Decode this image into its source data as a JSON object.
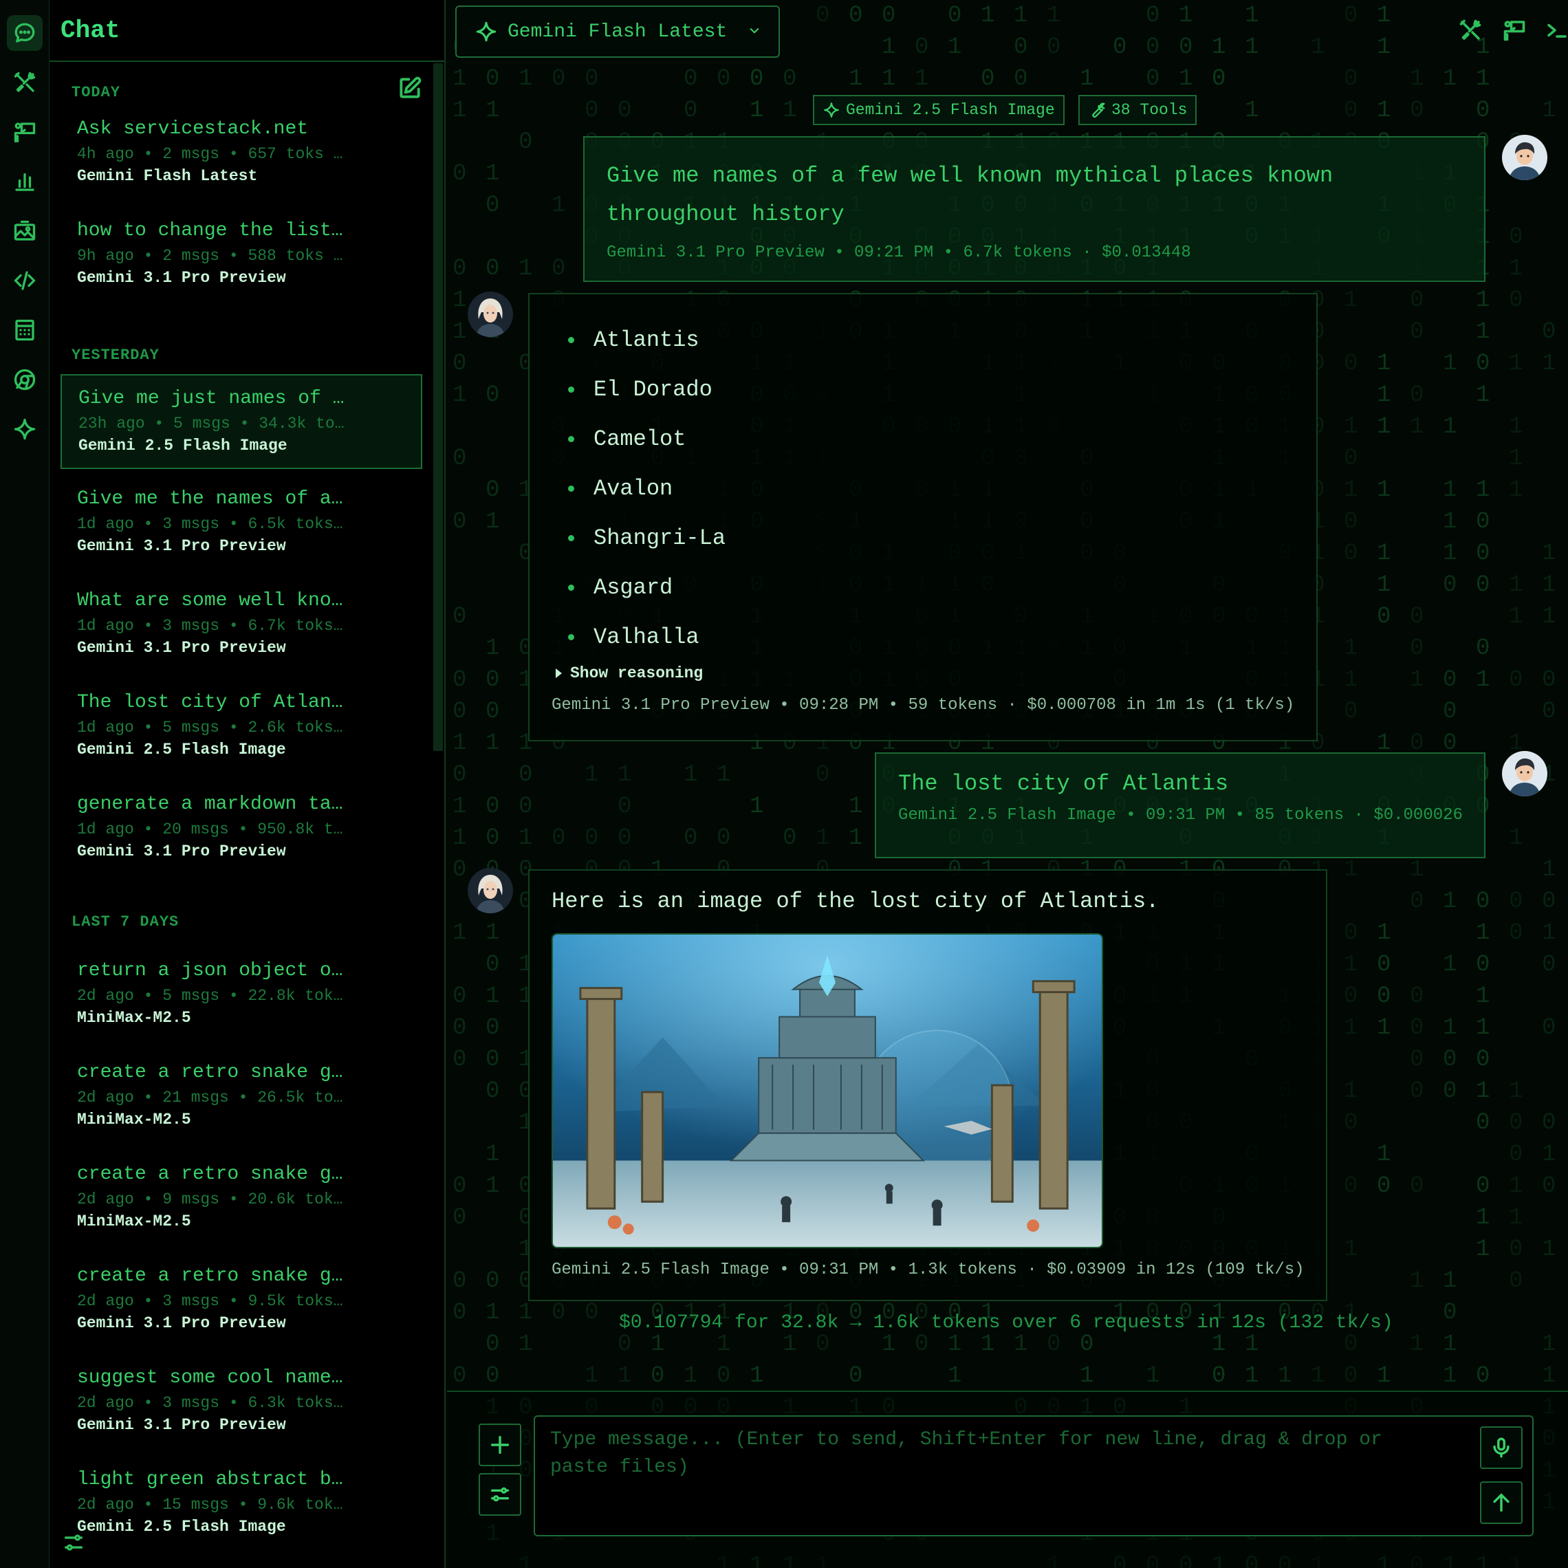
{
  "sidebar": {
    "title": "Chat",
    "groups": [
      {
        "label": "TODAY"
      },
      {
        "label": "YESTERDAY"
      },
      {
        "label": "LAST 7 DAYS"
      }
    ],
    "conversations": [
      {
        "title": "Ask servicestack.net",
        "meta": "4h ago • 2 msgs • 657 toks …",
        "model": "Gemini Flash Latest"
      },
      {
        "title": "how to change the list…",
        "meta": "9h ago • 2 msgs • 588 toks …",
        "model": "Gemini 3.1 Pro Preview"
      },
      {
        "title": "Give me just names of …",
        "meta": "23h ago • 5 msgs • 34.3k to…",
        "model": "Gemini 2.5 Flash Image"
      },
      {
        "title": "Give me the names of a…",
        "meta": "1d ago • 3 msgs • 6.5k toks…",
        "model": "Gemini 3.1 Pro Preview"
      },
      {
        "title": "What are some well kno…",
        "meta": "1d ago • 3 msgs • 6.7k toks…",
        "model": "Gemini 3.1 Pro Preview"
      },
      {
        "title": "The lost city of Atlan…",
        "meta": "1d ago • 5 msgs • 2.6k toks…",
        "model": "Gemini 2.5 Flash Image"
      },
      {
        "title": "generate a markdown ta…",
        "meta": "1d ago • 20 msgs • 950.8k t…",
        "model": "Gemini 3.1 Pro Preview"
      },
      {
        "title": "return a json object o…",
        "meta": "2d ago • 5 msgs • 22.8k tok…",
        "model": "MiniMax-M2.5"
      },
      {
        "title": "create a retro snake g…",
        "meta": "2d ago • 21 msgs • 26.5k to…",
        "model": "MiniMax-M2.5"
      },
      {
        "title": "create a retro snake g…",
        "meta": "2d ago • 9 msgs • 20.6k tok…",
        "model": "MiniMax-M2.5"
      },
      {
        "title": "create a retro snake g…",
        "meta": "2d ago • 3 msgs • 9.5k toks…",
        "model": "Gemini 3.1 Pro Preview"
      },
      {
        "title": "suggest some cool name…",
        "meta": "2d ago • 3 msgs • 6.3k toks…",
        "model": "Gemini 3.1 Pro Preview"
      },
      {
        "title": "light green abstract b…",
        "meta": "2d ago • 15 msgs • 9.6k tok…",
        "model": "Gemini 2.5 Flash Image"
      }
    ]
  },
  "header": {
    "model_select": "Gemini Flash Latest"
  },
  "chips": {
    "model": "Gemini 2.5 Flash Image",
    "tools": "38 Tools"
  },
  "messages": {
    "m1": {
      "text": "Give me names of a few well known mythical places known throughout history",
      "meta": "Gemini 3.1 Pro Preview • 09:21 PM • 6.7k tokens · $0.013448"
    },
    "m2": {
      "items": [
        "Atlantis",
        "El Dorado",
        "Camelot",
        "Avalon",
        "Shangri-La",
        "Asgard",
        "Valhalla"
      ],
      "reasoning": "Show reasoning",
      "meta": "Gemini 3.1 Pro Preview • 09:28 PM • 59 tokens · $0.000708 in 1m 1s (1 tk/s)"
    },
    "m3": {
      "text": "The lost city of Atlantis",
      "meta": "Gemini 2.5 Flash Image • 09:31 PM • 85 tokens · $0.000026"
    },
    "m4": {
      "text": "Here is an image of the lost city of Atlantis.",
      "meta": "Gemini 2.5 Flash Image • 09:31 PM • 1.3k tokens · $0.03909 in 12s (109 tk/s)"
    }
  },
  "summary": "$0.107794 for 32.8k → 1.6k tokens over 6 requests in 12s (132 tk/s)",
  "composer": {
    "placeholder": "Type message... (Enter to send, Shift+Enter for new line, drag & drop or paste files)"
  },
  "colors": {
    "accent": "#3ad068",
    "background": "#020804",
    "border": "#1c6a35"
  }
}
